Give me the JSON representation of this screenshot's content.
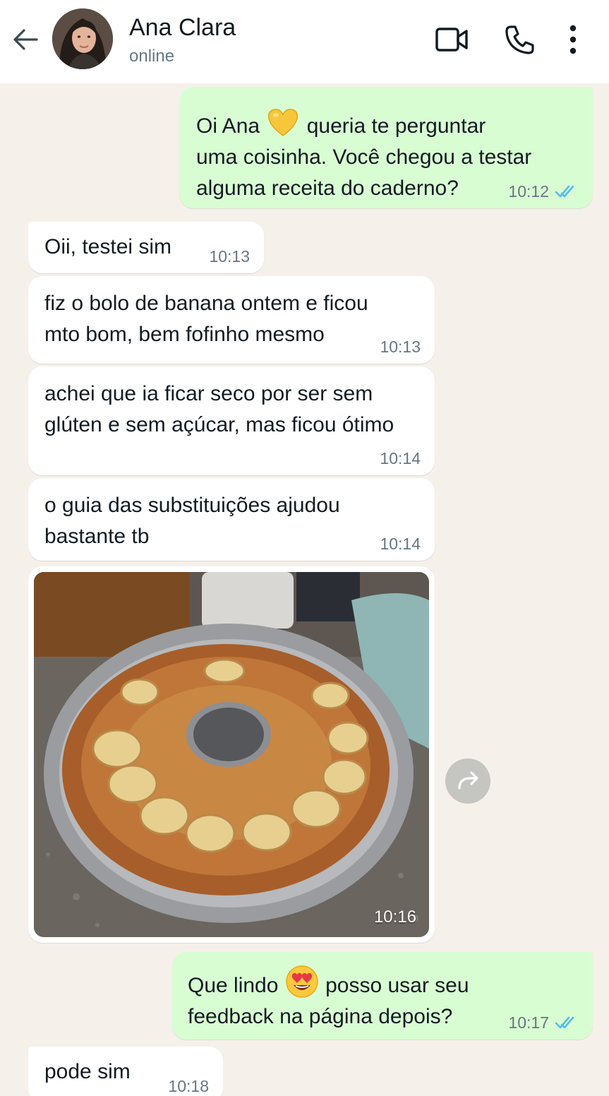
{
  "header": {
    "contact_name": "Ana Clara",
    "status": "online"
  },
  "icons": {
    "back": "arrow-left-icon",
    "video": "video-camera-icon",
    "call": "phone-icon",
    "menu": "more-vertical-icon",
    "forward": "forward-icon",
    "read": "double-check-icon"
  },
  "colors": {
    "outgoing_bubble": "#d9fdd3",
    "incoming_bubble": "#ffffff",
    "chat_background": "#f5f1ea",
    "read_ticks": "#53bdeb"
  },
  "messages": [
    {
      "direction": "out",
      "text_before": "Oi Ana ",
      "emoji": "yellow-heart",
      "text_after": " queria te perguntar\numa coisinha. Você chegou a testar\nalguma receita do caderno?",
      "time": "10:12",
      "status": "read"
    },
    {
      "direction": "in",
      "text": "Oii, testei sim",
      "time": "10:13"
    },
    {
      "direction": "in",
      "text": "fiz o bolo de banana ontem e ficou\nmto bom, bem fofinho mesmo",
      "time": "10:13"
    },
    {
      "direction": "in",
      "text": "achei que ia ficar seco por ser sem\nglúten e sem açúcar, mas ficou ótimo",
      "time": "10:14"
    },
    {
      "direction": "in",
      "text": "o guia das substituições ajudou\nbastante tb",
      "time": "10:14"
    },
    {
      "direction": "in",
      "type": "image",
      "image_description": "banana-cake-photo",
      "time": "10:16"
    },
    {
      "direction": "out",
      "text_before": "Que lindo ",
      "emoji": "heart-eyes",
      "text_after": " posso usar seu\nfeedback na página depois?",
      "time": "10:17",
      "status": "read"
    },
    {
      "direction": "in",
      "text": "pode sim",
      "time": "10:18"
    }
  ]
}
